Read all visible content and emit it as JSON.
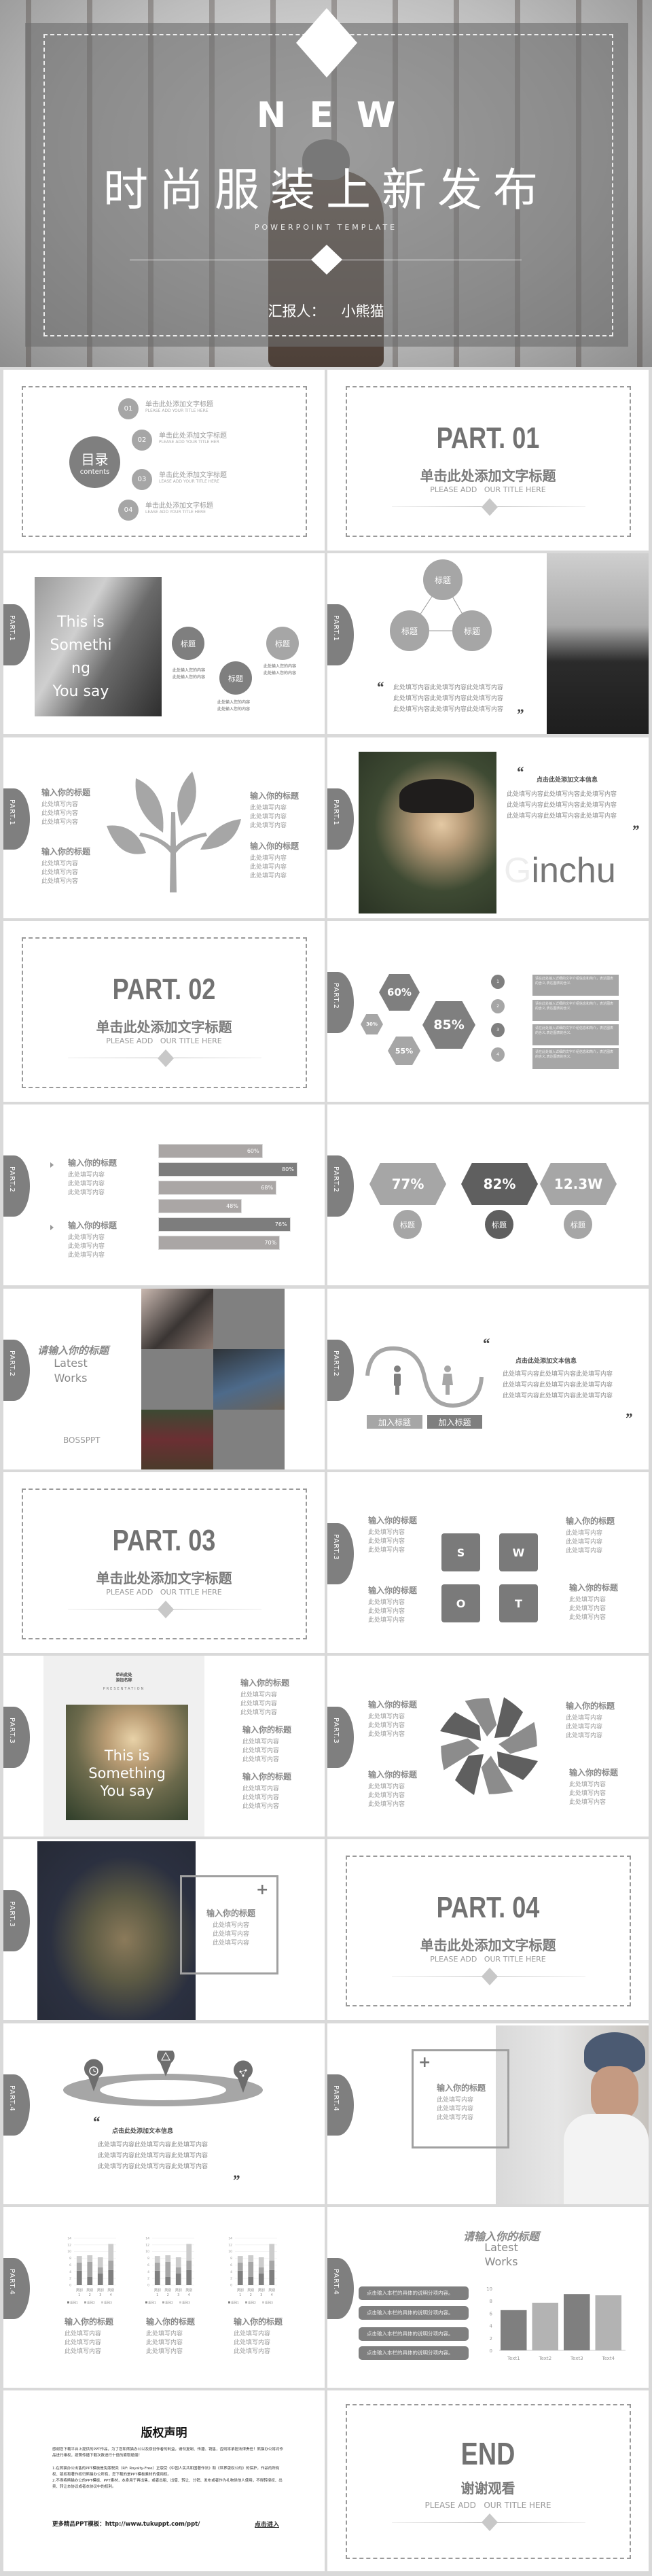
{
  "hero": {
    "new": "NEW",
    "title": "时尚服装上新发布",
    "subtitle": "POWERPOINT TEMPLATE",
    "reporter_label": "汇报人：",
    "reporter_name": "小熊猫"
  },
  "tabs": [
    "PART.1",
    "PART.2",
    "PART.3",
    "PART.4"
  ],
  "toc": {
    "title": "目录",
    "subtitle": "contents",
    "items": [
      {
        "num": "01",
        "title": "单击此处添加文字标题",
        "en": "PLEASE ADD YOUR TITLE HERE"
      },
      {
        "num": "02",
        "title": "单击此处添加文字标题",
        "en": "PLEASE ADD YOUR TITLE HER"
      },
      {
        "num": "03",
        "title": "单击此处添加文字标题",
        "en": "LEASE ADD YOUR TITLE HERE"
      },
      {
        "num": "04",
        "title": "单击此处添加文字标题",
        "en": "LEASE ADD YOUR TITLE HERE"
      }
    ]
  },
  "parts": [
    {
      "title": "PART. 01",
      "subtitle": "单击此处添加文字标题",
      "en": "PLEASE ADD   OUR TITLE HERE"
    },
    {
      "title": "PART. 02",
      "subtitle": "单击此处添加文字标题",
      "en": "PLEASE ADD   OUR TITLE HERE"
    },
    {
      "title": "PART. 03",
      "subtitle": "单击此处添加文字标题",
      "en": "PLEASE ADD   OUR TITLE HERE"
    },
    {
      "title": "PART. 04",
      "subtitle": "单击此处添加文字标题",
      "en": "PLEASE ADD   OUR TITLE HERE"
    }
  ],
  "something": {
    "photo_text": [
      "This is",
      "Somethi",
      "ng",
      "You say"
    ],
    "circles": [
      "标题",
      "标题",
      "标题"
    ],
    "captions": [
      [
        "此处输入您的内容",
        "此处输入您的内容"
      ],
      [
        "此处输入您的内容",
        "此处输入您的内容"
      ],
      [
        "此处输入您的内容",
        "此处输入您的内容"
      ]
    ]
  },
  "triangle": {
    "circles": [
      "标题",
      "标题",
      "标题"
    ],
    "open_quote": "“",
    "close_quote": "”",
    "lines": [
      "此处填写内容此处填写内容此处填写内容",
      "此处填写内容此处填写内容此处填写内容",
      "此处填写内容此处填写内容此处填写内容"
    ]
  },
  "tree": {
    "blocks": [
      {
        "title": "输入你的标题",
        "lines": [
          "此处填写内容",
          "此处填写内容",
          "此处填写内容"
        ]
      },
      {
        "title": "输入你的标题",
        "lines": [
          "此处填写内容",
          "此处填写内容",
          "此处填写内容"
        ]
      },
      {
        "title": "输入你的标题",
        "lines": [
          "此处填写内容",
          "此处填写内容",
          "此处填写内容"
        ]
      },
      {
        "title": "输入你的标题",
        "lines": [
          "此处填写内容",
          "此处填写内容",
          "此处填写内容"
        ]
      }
    ]
  },
  "ginchu": {
    "open_quote": "“",
    "close_quote": "”",
    "heading": "点击此处添加文本信息",
    "lines": [
      "此处填写内容此处填写内容此处填写内容",
      "此处填写内容此处填写内容此处填写内容",
      "此处填写内容此处填写内容此处填写内容"
    ],
    "big_initial": "G",
    "big_rest": "inchu"
  },
  "hexes": {
    "values": [
      "60%",
      "30%",
      "55%",
      "85%"
    ],
    "numbers": [
      "1",
      "2",
      "3",
      "4"
    ],
    "box_text": "请在此处输入详细的文字介绍信息和简介，表达图表的含义,表达图表的含义."
  },
  "progress": {
    "blocks": [
      {
        "title": "输入你的标题",
        "lines": [
          "此处填写内容",
          "此处填写内容",
          "此处填写内容"
        ]
      },
      {
        "title": "输入你的标题",
        "lines": [
          "此处填写内容",
          "此处填写内容",
          "此处填写内容"
        ]
      }
    ],
    "bars": [
      {
        "label": "60%",
        "value": 60,
        "color": "#aaa6a5"
      },
      {
        "label": "80%",
        "value": 80,
        "color": "#7d7d7d"
      },
      {
        "label": "68%",
        "value": 68,
        "color": "#aaa6a5"
      },
      {
        "label": "48%",
        "value": 48,
        "color": "#aaa6a5"
      },
      {
        "label": "76%",
        "value": 76,
        "color": "#7d7d7d"
      },
      {
        "label": "70%",
        "value": 70,
        "color": "#aaa6a5"
      }
    ]
  },
  "stats": {
    "values": [
      "77%",
      "82%",
      "12.3W"
    ],
    "labels": [
      "标题",
      "标题",
      "标题"
    ]
  },
  "works": {
    "title": "请输入你的标题",
    "latest": "Latest",
    "works": "Works",
    "brand": "BOSSPPT"
  },
  "wave": {
    "open_quote": "“",
    "close_quote": "”",
    "heading": "点击此处添加文本信息",
    "lines": [
      "此处填写内容此处填写内容此处填写内容",
      "此处填写内容此处填写内容此处填写内容",
      "此处填写内容此处填写内容此处填写内容"
    ],
    "buttons": [
      "加入标题",
      "加入标题"
    ]
  },
  "swot": {
    "letters": [
      "S",
      "W",
      "O",
      "T"
    ],
    "blocks": [
      {
        "title": "输入你的标题",
        "lines": [
          "此处填写内容",
          "此处填写内容",
          "此处填写内容"
        ]
      },
      {
        "title": "输入你的标题",
        "lines": [
          "此处填写内容",
          "此处填写内容",
          "此处填写内容"
        ]
      },
      {
        "title": "输入你的标题",
        "lines": [
          "此处填写内容",
          "此处填写内容",
          "此处填写内容"
        ]
      },
      {
        "title": "输入你的标题",
        "lines": [
          "此处填写内容",
          "此处填写内容",
          "此处填写内容"
        ]
      }
    ]
  },
  "presentation": {
    "name_lines": [
      "单击此处",
      "添加名称"
    ],
    "label": "PRESENTATION",
    "photo_text": [
      "This is",
      "Something",
      "You say"
    ],
    "blocks": [
      {
        "title": "输入你的标题",
        "lines": [
          "此处填写内容",
          "此处填写内容",
          "此处填写内容"
        ]
      },
      {
        "title": "输入你的标题",
        "lines": [
          "此处填写内容",
          "此处填写内容",
          "此处填写内容"
        ]
      },
      {
        "title": "输入你的标题",
        "lines": [
          "此处填写内容",
          "此处填写内容",
          "此处填写内容"
        ]
      }
    ]
  },
  "pinwheel": {
    "blocks": [
      {
        "title": "输入你的标题",
        "lines": [
          "此处填写内容",
          "此处填写内容",
          "此处填写内容"
        ]
      },
      {
        "title": "输入你的标题",
        "lines": [
          "此处填写内容",
          "此处填写内容",
          "此处填写内容"
        ]
      },
      {
        "title": "输入你的标题",
        "lines": [
          "此处填写内容",
          "此处填写内容",
          "此处填写内容"
        ]
      },
      {
        "title": "输入你的标题",
        "lines": [
          "此处填写内容",
          "此处填写内容",
          "此处填写内容"
        ]
      }
    ]
  },
  "glasses": {
    "plus": "+",
    "block": {
      "title": "输入你的标题",
      "lines": [
        "此处填写内容",
        "此处填写内容",
        "此处填写内容"
      ]
    }
  },
  "ring": {
    "open_quote": "“",
    "close_quote": "”",
    "heading": "点击此处添加文本信息",
    "lines": [
      "此处填写内容此处填写内容此处填写内容",
      "此处填写内容此处填写内容此处填写内容",
      "此处填写内容此处填写内容此处填写内容"
    ],
    "pins": [
      "clock-icon",
      "triangle-icon",
      "network-icon"
    ]
  },
  "capman": {
    "plus": "+",
    "block": {
      "title": "输入你的标题",
      "lines": [
        "此处填写内容",
        "此处填写内容",
        "此处填写内容"
      ]
    }
  },
  "minicharts": {
    "blocks": [
      {
        "title": "输入你的标题",
        "lines": [
          "此处填写内容",
          "此处填写内容",
          "此处填写内容"
        ]
      },
      {
        "title": "输入你的标题",
        "lines": [
          "此处填写内容",
          "此处填写内容",
          "此处填写内容"
        ]
      },
      {
        "title": "输入你的标题",
        "lines": [
          "此处填写内容",
          "此处填写内容",
          "此处填写内容"
        ]
      }
    ]
  },
  "latest_chart": {
    "title": "请输入你的标题",
    "latest": "Latest",
    "works": "Works",
    "pills": [
      "点击输入本栏的具体的说明分项内容。",
      "点击输入本栏的具体的说明分项内容。",
      "点击输入本栏的具体的说明分项内容。",
      "点击输入本栏的具体的说明分项内容。"
    ]
  },
  "copyright": {
    "title": "版权声明",
    "p1": "感谢您下载平台上提供的PPT作品，为了您和熊猫办公以及原创作者的利益，请勿复制、传播、销售，否则将承担法律责任！熊猫办公将对作品进行维权，按照传播下载次数进行十倍的索取赔偿！",
    "p2": "1.在熊猫办公出售的PPT模板是免版税类（RF: Royalty-Free）正版受《中国人民共和国著作法》和《世界版权公约》的保护，作品的所有权、版权和著作权归熊猫办公所有，您下载的是PPT模板素材的使用权。",
    "p3": "2.不得将熊猫办公的PPT模板、PPT素材，本身用于再出售，或者出租、出借、转让、分销、发布或者作为礼物供他人使用，不得转授权、出卖、转让本协议或者本协议中的权利。",
    "footer_link": "更多精品PPT模板：http://www.tukuppt.com/ppt/",
    "enter": "点击进入"
  },
  "end": {
    "title": "END",
    "subtitle": "谢谢观看",
    "en": "PLEASE ADD   OUR TITLE HERE"
  },
  "colors": {
    "dark": "#7f7f7f",
    "mid": "#a6a6a6",
    "light": "#cccccc",
    "background": "#d9d9d9"
  },
  "chart_data": [
    {
      "type": "bar",
      "stacked": true,
      "categories": [
        "类别1",
        "类别2",
        "类别3",
        "类别4"
      ],
      "series": [
        {
          "name": "系列1",
          "values": [
            4.3,
            2.5,
            3.5,
            4.5
          ]
        },
        {
          "name": "系列2",
          "values": [
            2.4,
            4.4,
            1.8,
            2.8
          ]
        },
        {
          "name": "系列3",
          "values": [
            2,
            2,
            3,
            5
          ]
        }
      ],
      "ylim": [
        0,
        14
      ],
      "yticks": [
        0,
        2,
        4,
        6,
        8,
        10,
        12,
        14
      ],
      "grid": true,
      "legend": "bottom"
    },
    {
      "type": "bar",
      "stacked": true,
      "categories": [
        "类别1",
        "类别2",
        "类别3",
        "类别4"
      ],
      "series": [
        {
          "name": "系列1",
          "values": [
            4.3,
            2.5,
            3.5,
            4.5
          ]
        },
        {
          "name": "系列2",
          "values": [
            2.4,
            4.4,
            1.8,
            2.8
          ]
        },
        {
          "name": "系列3",
          "values": [
            2,
            2,
            3,
            5
          ]
        }
      ],
      "ylim": [
        0,
        14
      ],
      "yticks": [
        0,
        2,
        4,
        6,
        8,
        10,
        12,
        14
      ],
      "grid": true,
      "legend": "bottom"
    },
    {
      "type": "bar",
      "stacked": true,
      "categories": [
        "类别1",
        "类别2",
        "类别3",
        "类别4"
      ],
      "series": [
        {
          "name": "系列1",
          "values": [
            4.3,
            2.5,
            3.5,
            4.5
          ]
        },
        {
          "name": "系列2",
          "values": [
            2.4,
            4.4,
            1.8,
            2.8
          ]
        },
        {
          "name": "系列3",
          "values": [
            2,
            2,
            3,
            5
          ]
        }
      ],
      "ylim": [
        0,
        14
      ],
      "yticks": [
        0,
        2,
        4,
        6,
        8,
        10,
        12,
        14
      ],
      "grid": true,
      "legend": "bottom"
    },
    {
      "type": "bar",
      "categories": [
        "Text1",
        "Text2",
        "Text3",
        "Text4"
      ],
      "values": [
        6.5,
        7.7,
        9.1,
        8.9
      ],
      "colors": [
        "#7f7f7f",
        "#b3b3b3",
        "#7f7f7f",
        "#b3b3b3"
      ],
      "ylim": [
        0,
        10
      ],
      "yticks": [
        0,
        2,
        4,
        6,
        8,
        10
      ],
      "grid": false
    }
  ]
}
